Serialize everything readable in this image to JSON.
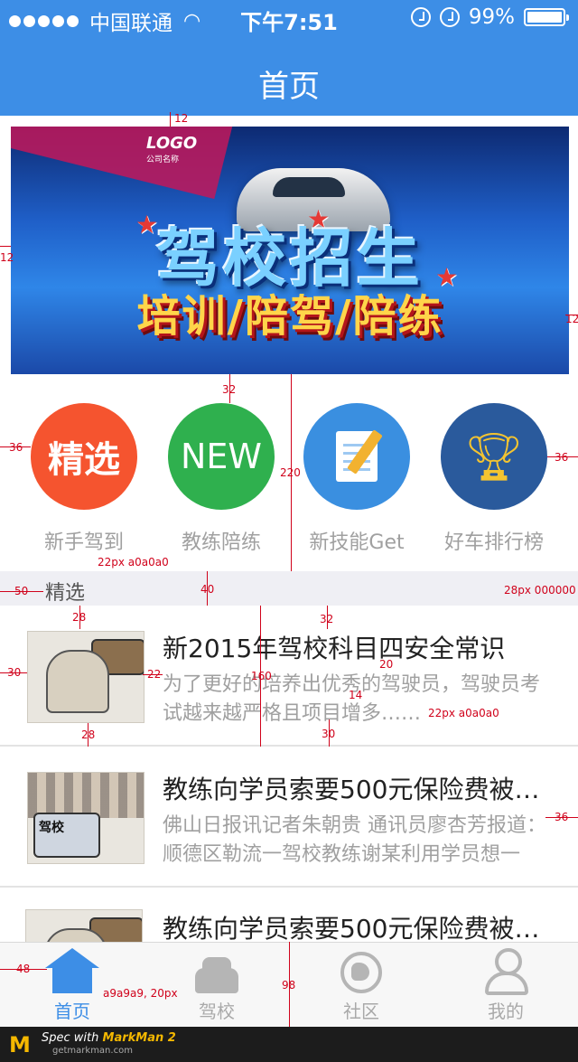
{
  "status_bar": {
    "carrier": "中国联通",
    "time": "下午7:51",
    "battery": "99%"
  },
  "header": {
    "title": "首页"
  },
  "banner": {
    "logo": "LOGO",
    "logo_sub": "公司名称",
    "title_main": "驾校招生",
    "title_sub": "培训/陪驾/陪练"
  },
  "categories": [
    {
      "icon_text": "精选",
      "label": "新手驾到",
      "color": "#f5542f"
    },
    {
      "icon_text": "NEW",
      "label": "教练陪练",
      "color": "#2fb04e"
    },
    {
      "icon_text": "",
      "label": "新技能Get",
      "color": "#3a8fe0",
      "icon": "notepad-pencil-icon"
    },
    {
      "icon_text": "",
      "label": "好车排行榜",
      "color": "#2a5a9c",
      "icon": "trophy-icon"
    }
  ],
  "section": {
    "title": "精选"
  },
  "news": [
    {
      "title": "新2015年驾校科目四安全常识",
      "desc": "为了更好的培养出优秀的驾驶员，驾驶员考试越来越严格且项目增多……"
    },
    {
      "title": "教练向学员索要500元保险费被…",
      "desc": "佛山日报讯记者朱朝贵 通讯员廖杏芳报道：顺德区勒流一驾校教练谢某利用学员想一过……",
      "thumb_text": "驾校"
    },
    {
      "title": "教练向学员索要500元保险费被…",
      "desc": ""
    }
  ],
  "tabs": [
    {
      "label": "首页",
      "icon": "home-icon",
      "active": true
    },
    {
      "label": "驾校",
      "icon": "car-icon",
      "active": false
    },
    {
      "label": "社区",
      "icon": "globe-icon",
      "active": false
    },
    {
      "label": "我的",
      "icon": "person-icon",
      "active": false
    }
  ],
  "footer": {
    "spec_prefix": "Spec with",
    "spec_brand": "MarkMan 2",
    "site": "getmarkman.com"
  },
  "annotations": {
    "a12_top": "12",
    "a12_left": "12",
    "a12_right": "12",
    "a32": "32",
    "a36_left": "36",
    "a36_right": "36",
    "a220": "220",
    "a22px": "22px  a0a0a0",
    "a40": "40",
    "a50": "50",
    "a28px": "28px  000000",
    "a28_top": "28",
    "a32b": "32",
    "a30": "30",
    "a22": "22",
    "a160": "160",
    "a20": "20",
    "a14": "14",
    "a22px_b": "22px  a0a0a0",
    "a28_bottom": "28",
    "a30b": "30",
    "a36_news": "36",
    "a48": "48",
    "a98": "98",
    "a_tab": "a9a9a9, 20px"
  },
  "colors": {
    "primary": "#3d8ee6",
    "section_bg": "#efeff4",
    "muted_text": "#a0a0a0",
    "tab_text": "#a9a9a9",
    "annotation": "#d0021b"
  }
}
